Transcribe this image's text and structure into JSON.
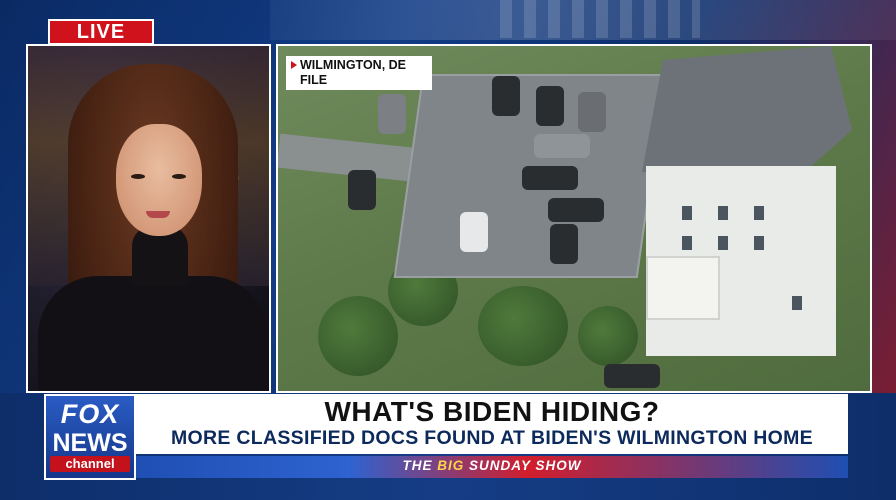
{
  "live_badge": "LIVE",
  "location_tag": {
    "line1": "WILMINGTON, DE",
    "line2": "FILE"
  },
  "network_logo": {
    "line1": "FOX",
    "line2": "NEWS",
    "line3": "channel"
  },
  "headline": "WHAT'S BIDEN HIDING?",
  "subheadline": "MORE CLASSIFIED DOCS FOUND AT BIDEN'S WILMINGTON HOME",
  "show_bar": {
    "prefix": "THE",
    "big": "BIG",
    "name": "SUNDAY SHOW"
  },
  "colors": {
    "accent_red": "#d0121c",
    "brand_blue": "#15368a"
  }
}
